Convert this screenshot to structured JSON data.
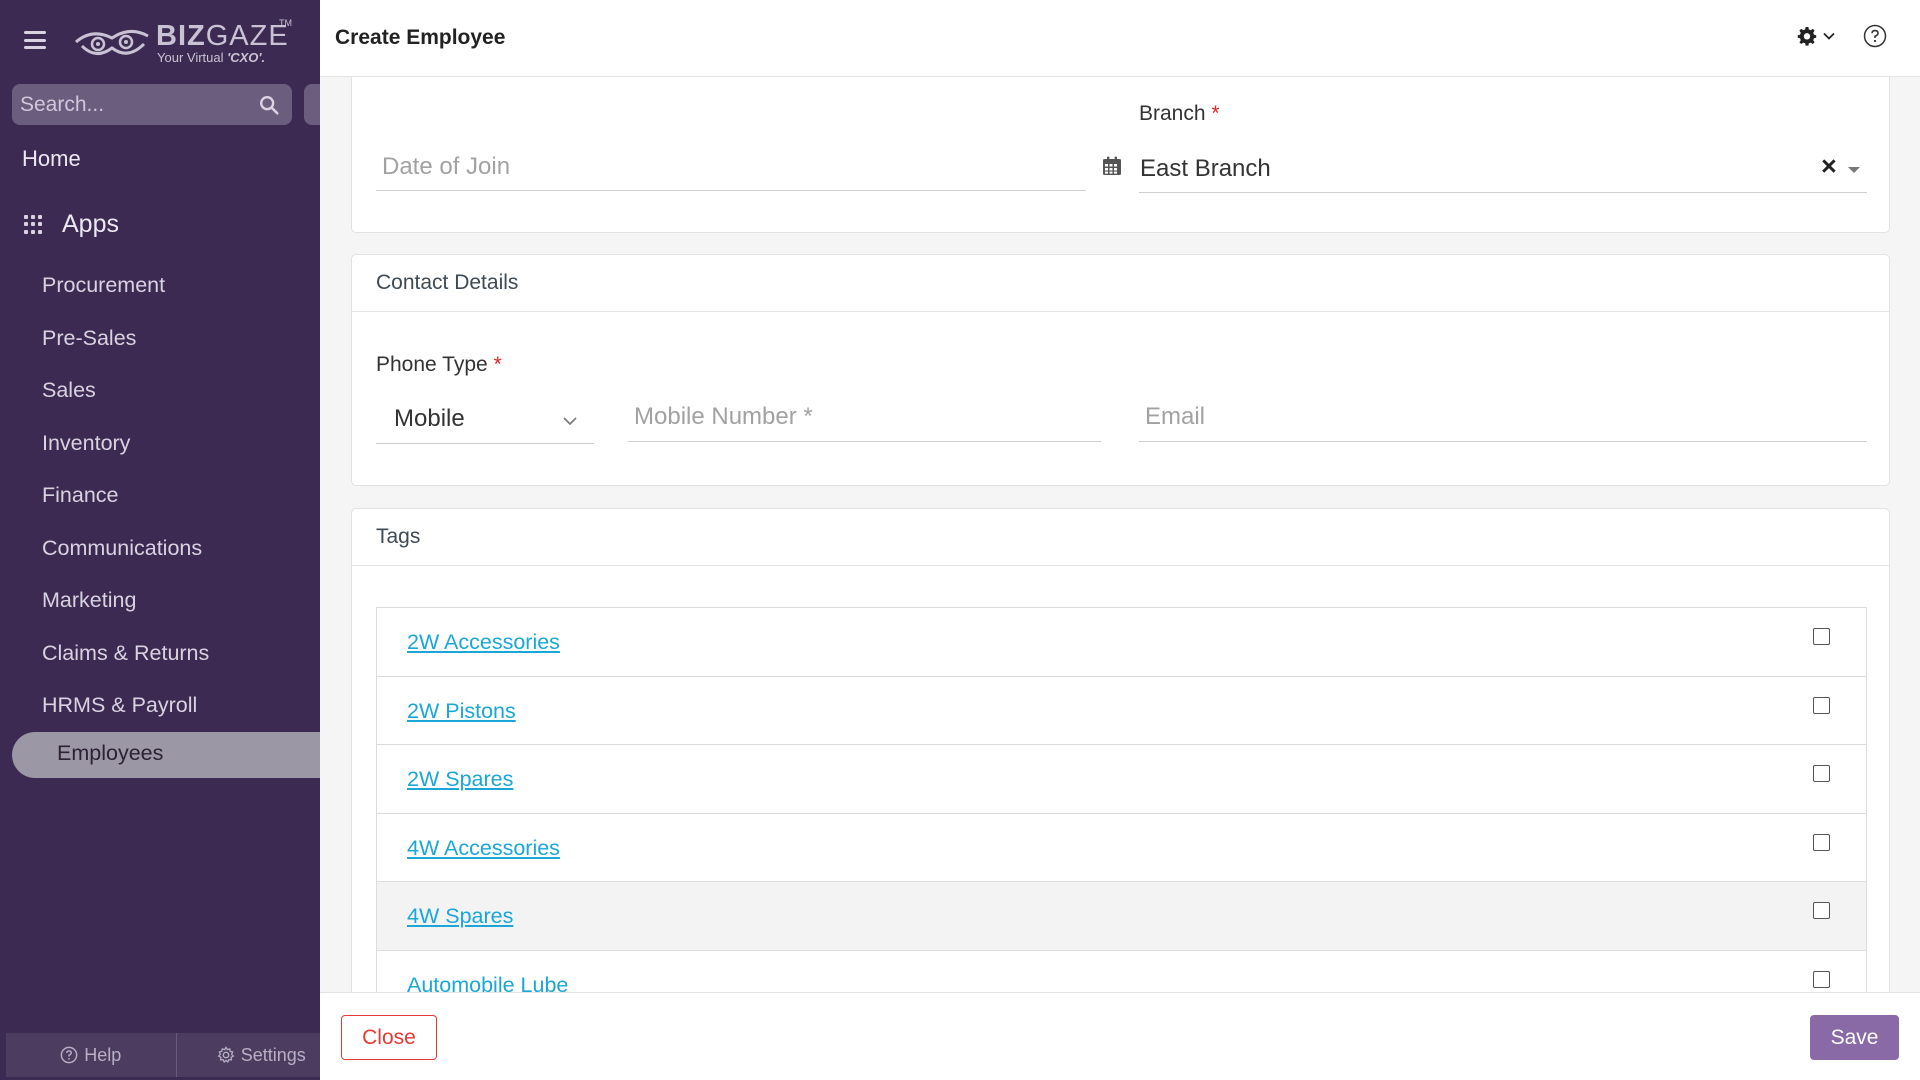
{
  "sidebar": {
    "logo": {
      "word_bold": "BIZ",
      "word_light": "GAZE",
      "tm": "TM",
      "tagline_prefix": "Your Virtual",
      "tagline_em": "'CXO'."
    },
    "search_placeholder": "Search...",
    "home_label": "Home",
    "apps_label": "Apps",
    "items": [
      {
        "label": "Procurement"
      },
      {
        "label": "Pre-Sales"
      },
      {
        "label": "Sales"
      },
      {
        "label": "Inventory"
      },
      {
        "label": "Finance"
      },
      {
        "label": "Communications"
      },
      {
        "label": "Marketing"
      },
      {
        "label": "Claims & Returns"
      },
      {
        "label": "HRMS & Payroll"
      }
    ],
    "active_item": "Employees",
    "footer": {
      "help_label": "Help",
      "settings_label": "Settings"
    }
  },
  "header": {
    "title": "Create Employee"
  },
  "form": {
    "date_of_join_placeholder": "Date of Join",
    "branch": {
      "label": "Branch",
      "required_mark": "*",
      "value": "East Branch",
      "clear_glyph": "×"
    },
    "contact": {
      "heading": "Contact Details",
      "phone_type": {
        "label": "Phone Type",
        "required_mark": "*",
        "value": "Mobile"
      },
      "mobile_placeholder": "Mobile Number *",
      "email_placeholder": "Email"
    },
    "tags": {
      "heading": "Tags",
      "items": [
        {
          "label": "2W Accessories",
          "checked": false
        },
        {
          "label": "2W Pistons",
          "checked": false
        },
        {
          "label": "2W Spares",
          "checked": false
        },
        {
          "label": "4W Accessories",
          "checked": false
        },
        {
          "label": "4W Spares",
          "checked": false
        },
        {
          "label": "Automobile Lube",
          "checked": false
        }
      ]
    }
  },
  "footer": {
    "close_label": "Close",
    "save_label": "Save"
  },
  "colors": {
    "sidebar_bg": "#3d2a52",
    "accent_save": "#8a6aa6",
    "close_red": "#e53935",
    "link": "#1aa7d8",
    "required": "#e02424"
  }
}
